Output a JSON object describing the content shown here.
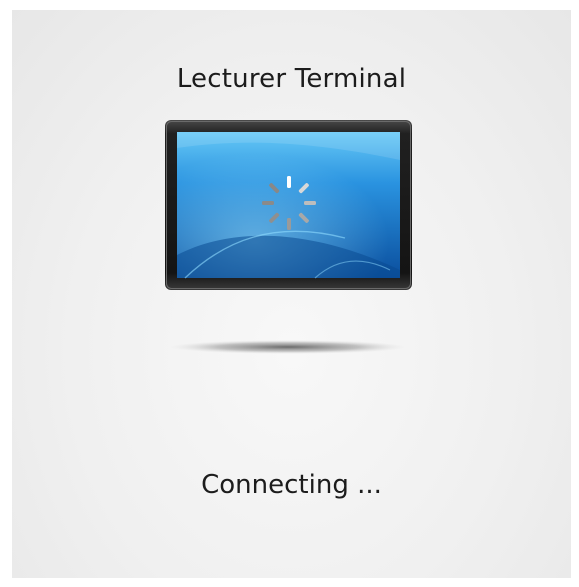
{
  "terminal": {
    "title": "Lecturer Terminal",
    "status": "Connecting ..."
  },
  "icons": {
    "monitor": "monitor-icon",
    "spinner": "loading-spinner-icon"
  },
  "colors": {
    "bezel": "#1e1e1e",
    "screen_top": "#4fb4ef",
    "screen_bottom": "#0a5fb3",
    "text": "#1c1c1c"
  }
}
